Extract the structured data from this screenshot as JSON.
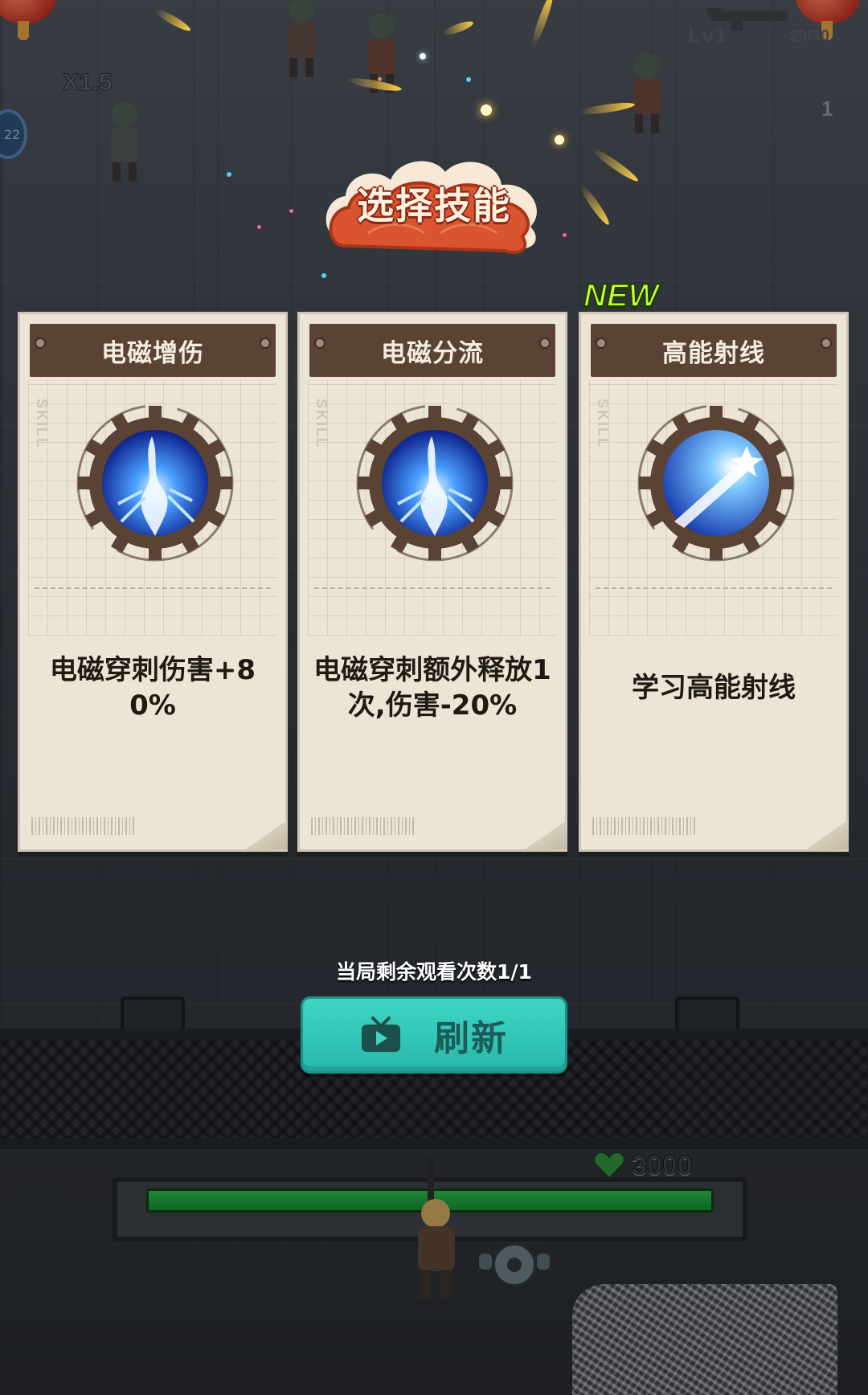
{
  "hud": {
    "multiplier": "X1.5",
    "badge": "22",
    "level": "Lv1",
    "ammo": "29/30",
    "count": "1"
  },
  "dialog": {
    "title": "选择技能",
    "new_tag": "NEW",
    "cards": [
      {
        "title": "电磁增伤",
        "tag": "SKILL",
        "icon": "electromagnetic-pierce-icon",
        "description": "电磁穿刺伤害+80%"
      },
      {
        "title": "电磁分流",
        "tag": "SKILL",
        "icon": "electromagnetic-pierce-icon",
        "description": "电磁穿刺额外释放1次,伤害-20%"
      },
      {
        "title": "高能射线",
        "tag": "SKILL",
        "icon": "energy-ray-icon",
        "description": "学习高能射线"
      }
    ],
    "remaining_views": "当局剩余观看次数1/1",
    "refresh_label": "刷新"
  },
  "base": {
    "hp": "3000",
    "hp_fraction": 1.0
  },
  "colors": {
    "refresh_button": "#2fc7b6",
    "card_header": "#5a4334",
    "new_tag": "#c6ff2e",
    "title_banner": "#d9542f",
    "hp_bar": "#1f9e3c"
  }
}
